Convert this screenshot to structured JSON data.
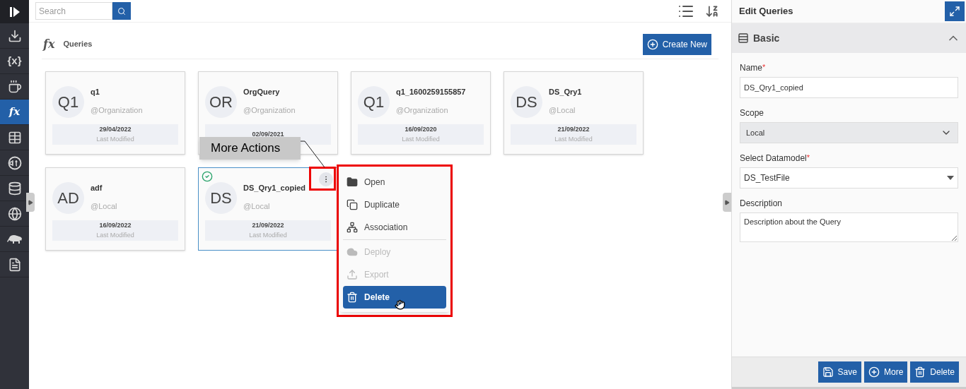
{
  "sidebar": {
    "items": [
      {
        "kind": "import",
        "selected": false
      },
      {
        "kind": "glyph",
        "glyph": "{x}",
        "selected": false
      },
      {
        "kind": "java",
        "selected": false
      },
      {
        "kind": "glyph",
        "glyph": "fx",
        "selected": true
      },
      {
        "kind": "table",
        "selected": false
      },
      {
        "kind": "dt",
        "selected": false
      },
      {
        "kind": "database",
        "selected": false
      },
      {
        "kind": "globe-gear",
        "selected": false
      },
      {
        "kind": "elephant",
        "selected": false
      },
      {
        "kind": "text-file",
        "selected": false
      }
    ]
  },
  "toolbar": {
    "search": {
      "placeholder": "Search"
    }
  },
  "page_header": {
    "icon_text": "fx",
    "title": "Queries",
    "create_button": "Create New"
  },
  "cards": [
    {
      "initials": "Q1",
      "name": "q1",
      "scope": "@Organization",
      "date": "29/04/2022",
      "date_label": "Last Modified",
      "selected": false
    },
    {
      "initials": "OR",
      "name": "OrgQuery",
      "scope": "@Organization",
      "date": "02/09/2021",
      "selected": false
    },
    {
      "initials": "Q1",
      "name": "q1_1600259155857",
      "scope": "@Organization",
      "date": "16/09/2020",
      "date_label": "Last Modified",
      "selected": false
    },
    {
      "initials": "DS",
      "name": "DS_Qry1",
      "scope": "@Local",
      "date": "21/09/2022",
      "date_label": "Last Modified",
      "selected": false
    },
    {
      "initials": "AD",
      "name": "adf",
      "scope": "@Local",
      "date": "16/09/2022",
      "date_label": "Last Modified",
      "selected": false
    },
    {
      "initials": "DS",
      "name": "DS_Qry1_copied",
      "scope": "@Local",
      "date": "21/09/2022",
      "date_label": "Last Modified",
      "selected": true
    }
  ],
  "context_menu": {
    "items": [
      {
        "kind": "open",
        "label": "Open",
        "disabled": false,
        "selected": false
      },
      {
        "kind": "duplicate",
        "label": "Duplicate",
        "disabled": false,
        "selected": false
      },
      {
        "kind": "association",
        "label": "Association",
        "disabled": false,
        "selected": false
      },
      {
        "kind": "deploy",
        "label": "Deploy",
        "disabled": true,
        "selected": false
      },
      {
        "kind": "export",
        "label": "Export",
        "disabled": true,
        "selected": false
      },
      {
        "kind": "delete",
        "label": "Delete",
        "disabled": false,
        "selected": true
      }
    ]
  },
  "callout": {
    "text": "More Actions"
  },
  "edit_panel": {
    "title": "Edit Queries",
    "section": {
      "title": "Basic",
      "expanded": true
    },
    "fields": [
      {
        "kind": "text",
        "label": "Name",
        "required_mark": "*",
        "value": "DS_Qry1_copied"
      },
      {
        "kind": "select",
        "label": "Scope",
        "value": "Local"
      },
      {
        "kind": "dropdown",
        "label": "Select Datamodel",
        "required_mark": "*",
        "value": "DS_TestFile"
      },
      {
        "kind": "textarea",
        "label": "Description",
        "value": "Description about the Query"
      }
    ],
    "buttons": [
      {
        "kind": "save",
        "label": "Save"
      },
      {
        "kind": "more",
        "label": "More"
      },
      {
        "kind": "delete",
        "label": "Delete"
      }
    ]
  }
}
